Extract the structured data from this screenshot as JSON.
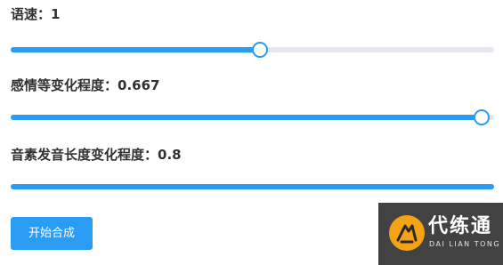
{
  "settings": [
    {
      "label": "语速：",
      "value_text": "1",
      "level": 0.515,
      "thumb_visible": true
    },
    {
      "label": "感情等变化程度：",
      "value_text": "0.667",
      "level": 0.975,
      "thumb_visible": true
    },
    {
      "label": "音素发音长度变化程度：",
      "value_text": "0.8",
      "level": 1.0,
      "thumb_visible": false
    }
  ],
  "actions": {
    "start_label": "开始合成"
  },
  "watermark": {
    "title": "代练通",
    "subtitle": "DAI LIAN TONG"
  },
  "colors": {
    "accent": "#2b9cf3",
    "track": "#e4e7ed",
    "text": "#303133"
  }
}
